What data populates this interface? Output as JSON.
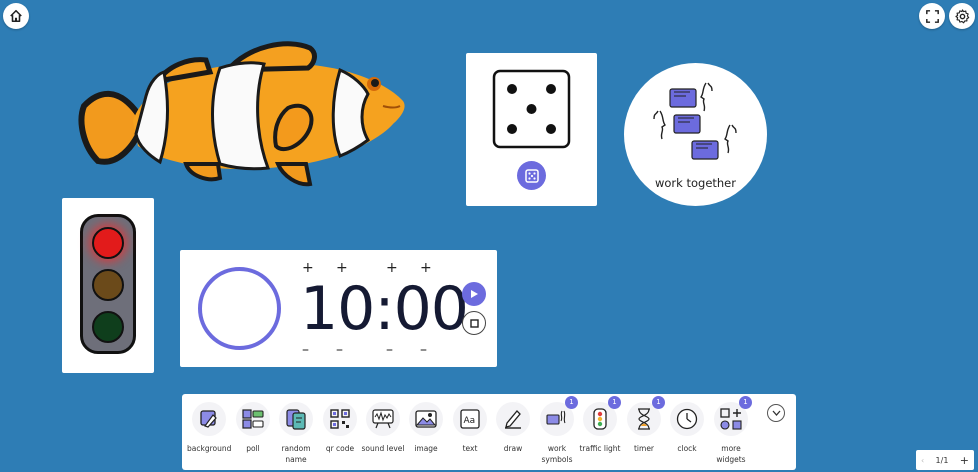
{
  "top_bar": {
    "home_icon": "home-icon",
    "fullscreen_icon": "fullscreen-icon",
    "settings_icon": "gear-icon"
  },
  "work_symbol": {
    "label": "work together"
  },
  "timer": {
    "display": "10:00",
    "plus": "+",
    "minus": "–",
    "ring_color": "#6c6bde"
  },
  "traffic_light": {
    "red": "#e21b1b",
    "amber": "#6b4a1a",
    "green": "#0f3e1c"
  },
  "toolbar": {
    "items": [
      {
        "label": "background",
        "icon": "background-icon",
        "badge": ""
      },
      {
        "label": "poll",
        "icon": "poll-icon",
        "badge": ""
      },
      {
        "label": "random name",
        "icon": "random-name-icon",
        "badge": ""
      },
      {
        "label": "qr code",
        "icon": "qr-code-icon",
        "badge": ""
      },
      {
        "label": "sound level",
        "icon": "sound-level-icon",
        "badge": ""
      },
      {
        "label": "image",
        "icon": "image-icon",
        "badge": ""
      },
      {
        "label": "text",
        "icon": "text-icon",
        "badge": ""
      },
      {
        "label": "draw",
        "icon": "draw-icon",
        "badge": ""
      },
      {
        "label": "work symbols",
        "icon": "work-symbols-icon",
        "badge": "1"
      },
      {
        "label": "traffic light",
        "icon": "traffic-light-icon",
        "badge": "1"
      },
      {
        "label": "timer",
        "icon": "hourglass-icon",
        "badge": "1"
      },
      {
        "label": "clock",
        "icon": "clock-icon",
        "badge": ""
      },
      {
        "label": "more widgets",
        "icon": "more-widgets-icon",
        "badge": "1"
      }
    ]
  },
  "pager": {
    "page": "1/1",
    "add": "+"
  },
  "colors": {
    "background": "#2e7db5",
    "accent": "#6c6bde"
  }
}
